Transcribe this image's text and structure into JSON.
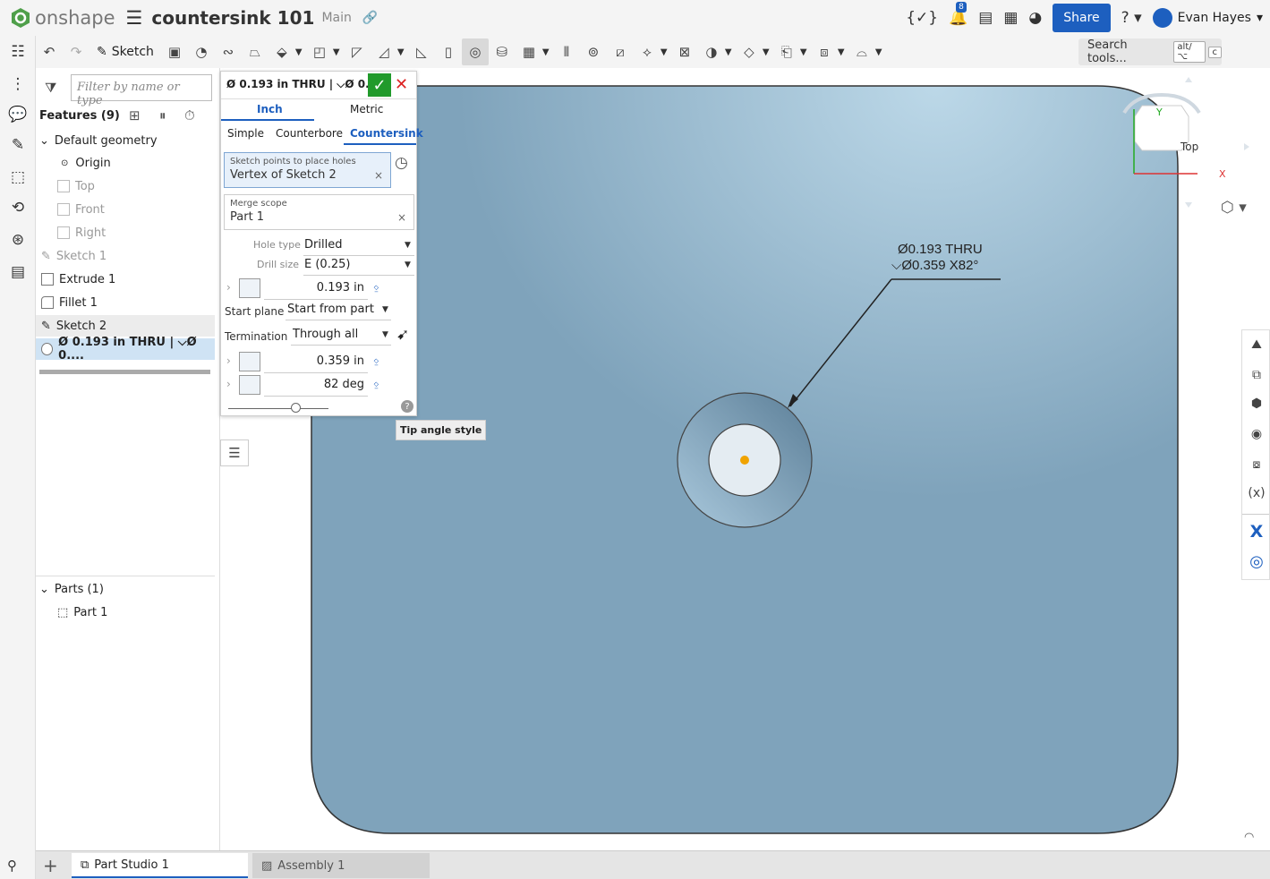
{
  "app": {
    "name": "onshape",
    "doc_title": "countersink 101",
    "branch": "Main",
    "notifications": "8",
    "share": "Share",
    "help": "?",
    "user": "Evan Hayes"
  },
  "toolbar": {
    "sketch": "Sketch",
    "search_label": "Search tools...",
    "search_key1": "alt/⌥",
    "search_key2": "c"
  },
  "features": {
    "filter_placeholder": "Filter by name or type",
    "header": "Features (9)",
    "default_geometry": "Default geometry",
    "origin": "Origin",
    "top": "Top",
    "front": "Front",
    "right": "Right",
    "items": [
      "Sketch 1",
      "Extrude 1",
      "Fillet 1",
      "Sketch 2",
      "Ø 0.193 in THRU | ⌵Ø 0...."
    ],
    "parts_header": "Parts (1)",
    "part": "Part 1"
  },
  "dialog": {
    "title": "Ø 0.193 in THRU | ⌵Ø 0.3...",
    "unit_tabs": [
      "Inch",
      "Metric"
    ],
    "type_tabs": [
      "Simple",
      "Counterbore",
      "Countersink"
    ],
    "sketch_points_label": "Sketch points to place holes",
    "sketch_points_value": "Vertex of Sketch 2",
    "merge_label": "Merge scope",
    "merge_value": "Part 1",
    "hole_type_label": "Hole type",
    "hole_type": "Drilled",
    "drill_size_label": "Drill size",
    "drill_size": "E (0.25)",
    "diameter": "0.193 in",
    "start_plane_label": "Start plane",
    "start_plane": "Start from part",
    "termination_label": "Termination",
    "termination": "Through all",
    "cs_diameter": "0.359 in",
    "cs_angle": "82 deg",
    "slider_fraction": 0.7,
    "tooltip": "Tip angle style"
  },
  "viewport": {
    "callout_line1": "Ø0.193 THRU",
    "callout_line2": "⌵Ø0.359 X82°",
    "view_cube": "Top",
    "axis_x": "X",
    "axis_y": "Y",
    "colors": {
      "part": "#7fa3bb",
      "part_light": "#bcd8e8",
      "hole_center": "#f0a300"
    }
  },
  "tabs": {
    "part_studio": "Part Studio 1",
    "assembly": "Assembly 1"
  }
}
